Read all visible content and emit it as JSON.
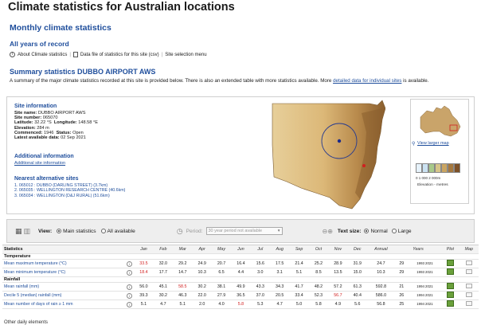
{
  "page": {
    "title": "Climate statistics for Australian locations",
    "section_title": "Monthly climate statistics",
    "all_years": "All years of record",
    "links": {
      "about": "About Climate statistics",
      "data_file": "Data file of statistics for this site (csv)",
      "site_selection": "Site selection menu"
    },
    "summary_title": "Summary statistics DUBBO AIRPORT AWS",
    "summary_text": "A summary of the major climate statistics recorded at this site is provided below. There is also an extended table with more statistics available. More",
    "summary_link": "detailed data for individual sites",
    "summary_tail": "is available."
  },
  "site": {
    "heading": "Site information",
    "name_label": "Site name:",
    "name": "DUBBO AIRPORT AWS",
    "number_label": "Site number:",
    "number": "065070",
    "lat_label": "Latitude:",
    "lat": "32.22 °S",
    "lon_label": "Longitude:",
    "lon": "148.58 °E",
    "elev_label": "Elevation:",
    "elev": "284 m",
    "commenced_label": "Commenced:",
    "commenced": "1946",
    "status_label": "Status:",
    "status": "Open",
    "latest_label": "Latest available data:",
    "latest": "02 Sep 2021",
    "additional_heading": "Additional information",
    "additional_link": "Additional site information",
    "nearest_heading": "Nearest alternative sites",
    "nearest": [
      "1. 065012 : DUBBO (DARLING STREET) (3.7km)",
      "2. 065035 : WELLINGTON RESEARCH CENTRE (40.6km)",
      "3. 065034 : WELLINGTON (D&J RURAL) (51.6km)"
    ]
  },
  "map_panel": {
    "view_larger": "View larger map",
    "legend_ticks": "0 1 000 2 000m",
    "legend_caption": "Elevation - metres",
    "legend_colors": [
      "#e6f2fb",
      "#cbe2f2",
      "#a8c98a",
      "#d6c58a",
      "#caa561",
      "#a5783e",
      "#7d5128"
    ]
  },
  "toolbar": {
    "view_label": "View:",
    "main_stats": "Main statistics",
    "all_available": "All available",
    "period_label": "Period:",
    "period_placeholder": "30 year period not available",
    "text_size_label": "Text size:",
    "normal": "Normal",
    "large": "Large"
  },
  "table": {
    "headers": {
      "statistics": "Statistics",
      "months": [
        "Jan",
        "Feb",
        "Mar",
        "Apr",
        "May",
        "Jun",
        "Jul",
        "Aug",
        "Sep",
        "Oct",
        "Nov",
        "Dec"
      ],
      "annual": "Annual",
      "years": "Years",
      "plot": "Plot",
      "map": "Map"
    },
    "groups": [
      {
        "name": "Temperature",
        "rows": [
          {
            "label": "Mean maximum temperature (°C)",
            "values": [
              "33.5",
              "32.0",
              "29.2",
              "24.9",
              "20.7",
              "16.4",
              "15.6",
              "17.5",
              "21.4",
              "25.2",
              "28.9",
              "31.9"
            ],
            "red_index": 0,
            "annual": "24.7",
            "n": "29",
            "years": "1993 2021"
          },
          {
            "label": "Mean minimum temperature (°C)",
            "values": [
              "18.4",
              "17.7",
              "14.7",
              "10.3",
              "6.5",
              "4.4",
              "3.0",
              "3.1",
              "5.1",
              "8.5",
              "13.5",
              "15.0"
            ],
            "red_index": 0,
            "annual": "10.3",
            "n": "29",
            "years": "1993 2021"
          }
        ]
      },
      {
        "name": "Rainfall",
        "rows": [
          {
            "label": "Mean rainfall (mm)",
            "values": [
              "56.0",
              "45.1",
              "58.5",
              "30.2",
              "38.1",
              "49.9",
              "43.3",
              "34.3",
              "41.7",
              "48.2",
              "57.2",
              "61.3"
            ],
            "red_index": 2,
            "annual": "592.8",
            "n": "21",
            "years": "1994 2021"
          },
          {
            "label": "Decile 5 (median) rainfall (mm)",
            "values": [
              "39.3",
              "30.2",
              "46.3",
              "22.0",
              "27.9",
              "36.5",
              "37.0",
              "20.5",
              "33.4",
              "52.3",
              "56.7",
              "40.4"
            ],
            "red_index": 10,
            "annual": "586.0",
            "n": "26",
            "years": "1994 2021"
          },
          {
            "label": "Mean number of days of rain ≥ 1 mm",
            "values": [
              "5.1",
              "4.7",
              "5.1",
              "2.0",
              "4.0",
              "5.8",
              "5.3",
              "4.7",
              "5.0",
              "5.8",
              "4.9",
              "5.6"
            ],
            "red_index": 5,
            "annual": "56.8",
            "n": "25",
            "years": "1994 2021"
          }
        ]
      }
    ]
  },
  "footer": {
    "next_group": "Other daily elements"
  }
}
